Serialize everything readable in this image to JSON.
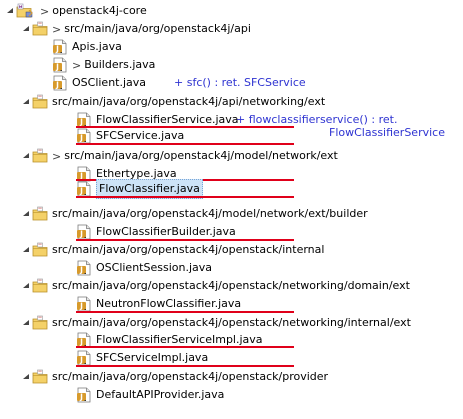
{
  "colors": {
    "underline": "#e0001a",
    "annotation": "#2e33d1",
    "selection": "#cde3f7",
    "folder": "#e8c04a",
    "java_file": "#d79a2b"
  },
  "tree": {
    "project": {
      "decoration": ">",
      "label": "openstack4j-core",
      "icon": "project-icon"
    },
    "packages": [
      {
        "decoration": ">",
        "label": "src/main/java/org/openstack4j/api",
        "expanded": true,
        "files": [
          {
            "label": "Apis.java"
          },
          {
            "decoration": ">",
            "label": "Builders.java"
          },
          {
            "label": "OSClient.java"
          }
        ]
      },
      {
        "label": "src/main/java/org/openstack4j/api/networking/ext",
        "expanded": true,
        "files": [
          {
            "label": "FlowClassifierService.java"
          },
          {
            "label": "SFCService.java"
          }
        ]
      },
      {
        "decoration": ">",
        "label": "src/main/java/org/openstack4j/model/network/ext",
        "expanded": true,
        "files": [
          {
            "label": "Ethertype.java"
          },
          {
            "label": "FlowClassifier.java",
            "selected": true
          }
        ]
      },
      {
        "label": "src/main/java/org/openstack4j/model/network/ext/builder",
        "expanded": true,
        "files": [
          {
            "label": "FlowClassifierBuilder.java"
          }
        ]
      },
      {
        "label": "src/main/java/org/openstack4j/openstack/internal",
        "expanded": true,
        "files": [
          {
            "label": "OSClientSession.java"
          }
        ]
      },
      {
        "label": "src/main/java/org/openstack4j/openstack/networking/domain/ext",
        "expanded": true,
        "files": [
          {
            "label": "NeutronFlowClassifier.java"
          }
        ]
      },
      {
        "label": "src/main/java/org/openstack4j/openstack/networking/internal/ext",
        "expanded": true,
        "files": [
          {
            "label": "FlowClassifierServiceImpl.java"
          },
          {
            "label": "SFCServiceImpl.java"
          }
        ]
      },
      {
        "label": "src/main/java/org/openstack4j/openstack/provider",
        "expanded": true,
        "files": [
          {
            "label": "DefaultAPIProvider.java"
          }
        ]
      }
    ]
  },
  "annotations": {
    "osclient": "+ sfc() : ret. SFCService",
    "flowclassifier_line1": "+ flowclassifierservice() : ret.",
    "flowclassifier_line2": "FlowClassifierService"
  }
}
